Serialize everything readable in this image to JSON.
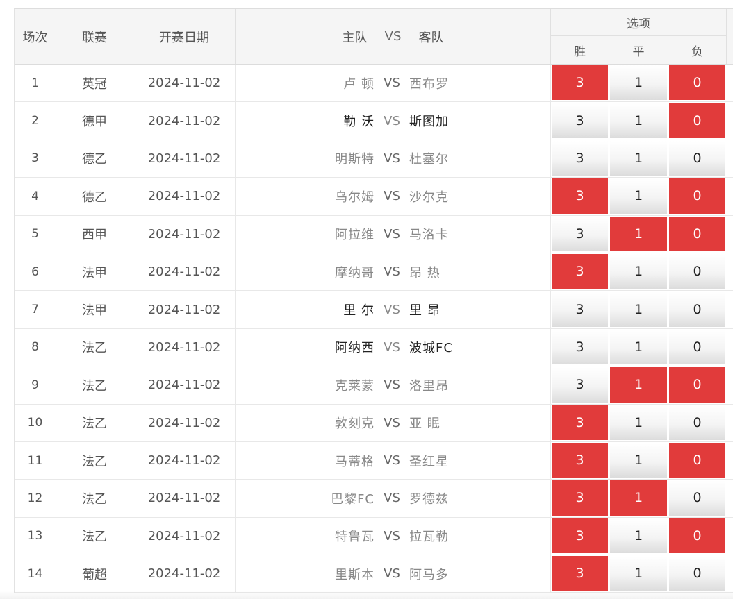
{
  "header": {
    "col_no": "场次",
    "col_league": "联赛",
    "col_date": "开赛日期",
    "col_home": "主队",
    "col_vs": "VS",
    "col_away": "客队",
    "options_title": "选项",
    "opt_win": "胜",
    "opt_draw": "平",
    "opt_lose": "负"
  },
  "colors": {
    "selected": "#e13b3b",
    "header_bg": "#f5f5f5"
  },
  "rows": [
    {
      "no": "1",
      "league": "英冠",
      "date": "2024-11-02",
      "home": "卢 顿",
      "vs": "VS",
      "away": "西布罗",
      "emph": false,
      "win": "3",
      "draw": "1",
      "lose": "0",
      "sel_win": true,
      "sel_draw": false,
      "sel_lose": true
    },
    {
      "no": "2",
      "league": "德甲",
      "date": "2024-11-02",
      "home": "勒 沃",
      "vs": "VS",
      "away": "斯图加",
      "emph": true,
      "win": "3",
      "draw": "1",
      "lose": "0",
      "sel_win": false,
      "sel_draw": false,
      "sel_lose": true
    },
    {
      "no": "3",
      "league": "德乙",
      "date": "2024-11-02",
      "home": "明斯特",
      "vs": "VS",
      "away": "杜塞尔",
      "emph": false,
      "win": "3",
      "draw": "1",
      "lose": "0",
      "sel_win": false,
      "sel_draw": false,
      "sel_lose": false
    },
    {
      "no": "4",
      "league": "德乙",
      "date": "2024-11-02",
      "home": "乌尔姆",
      "vs": "VS",
      "away": "沙尔克",
      "emph": false,
      "win": "3",
      "draw": "1",
      "lose": "0",
      "sel_win": true,
      "sel_draw": false,
      "sel_lose": true
    },
    {
      "no": "5",
      "league": "西甲",
      "date": "2024-11-02",
      "home": "阿拉维",
      "vs": "VS",
      "away": "马洛卡",
      "emph": false,
      "win": "3",
      "draw": "1",
      "lose": "0",
      "sel_win": false,
      "sel_draw": true,
      "sel_lose": true
    },
    {
      "no": "6",
      "league": "法甲",
      "date": "2024-11-02",
      "home": "摩纳哥",
      "vs": "VS",
      "away": "昂 热",
      "emph": false,
      "win": "3",
      "draw": "1",
      "lose": "0",
      "sel_win": true,
      "sel_draw": false,
      "sel_lose": false
    },
    {
      "no": "7",
      "league": "法甲",
      "date": "2024-11-02",
      "home": "里 尔",
      "vs": "VS",
      "away": "里 昂",
      "emph": true,
      "win": "3",
      "draw": "1",
      "lose": "0",
      "sel_win": false,
      "sel_draw": false,
      "sel_lose": false
    },
    {
      "no": "8",
      "league": "法乙",
      "date": "2024-11-02",
      "home": "阿纳西",
      "vs": "VS",
      "away": "波城FC",
      "emph": true,
      "win": "3",
      "draw": "1",
      "lose": "0",
      "sel_win": false,
      "sel_draw": false,
      "sel_lose": false
    },
    {
      "no": "9",
      "league": "法乙",
      "date": "2024-11-02",
      "home": "克莱蒙",
      "vs": "VS",
      "away": "洛里昂",
      "emph": false,
      "win": "3",
      "draw": "1",
      "lose": "0",
      "sel_win": false,
      "sel_draw": true,
      "sel_lose": true
    },
    {
      "no": "10",
      "league": "法乙",
      "date": "2024-11-02",
      "home": "敦刻克",
      "vs": "VS",
      "away": "亚 眠",
      "emph": false,
      "win": "3",
      "draw": "1",
      "lose": "0",
      "sel_win": true,
      "sel_draw": false,
      "sel_lose": false
    },
    {
      "no": "11",
      "league": "法乙",
      "date": "2024-11-02",
      "home": "马蒂格",
      "vs": "VS",
      "away": "圣红星",
      "emph": false,
      "win": "3",
      "draw": "1",
      "lose": "0",
      "sel_win": true,
      "sel_draw": false,
      "sel_lose": true
    },
    {
      "no": "12",
      "league": "法乙",
      "date": "2024-11-02",
      "home": "巴黎FC",
      "vs": "VS",
      "away": "罗德兹",
      "emph": false,
      "win": "3",
      "draw": "1",
      "lose": "0",
      "sel_win": true,
      "sel_draw": true,
      "sel_lose": false
    },
    {
      "no": "13",
      "league": "法乙",
      "date": "2024-11-02",
      "home": "特鲁瓦",
      "vs": "VS",
      "away": "拉瓦勒",
      "emph": false,
      "win": "3",
      "draw": "1",
      "lose": "0",
      "sel_win": true,
      "sel_draw": false,
      "sel_lose": true
    },
    {
      "no": "14",
      "league": "葡超",
      "date": "2024-11-02",
      "home": "里斯本",
      "vs": "VS",
      "away": "阿马多",
      "emph": false,
      "win": "3",
      "draw": "1",
      "lose": "0",
      "sel_win": true,
      "sel_draw": false,
      "sel_lose": false
    }
  ]
}
